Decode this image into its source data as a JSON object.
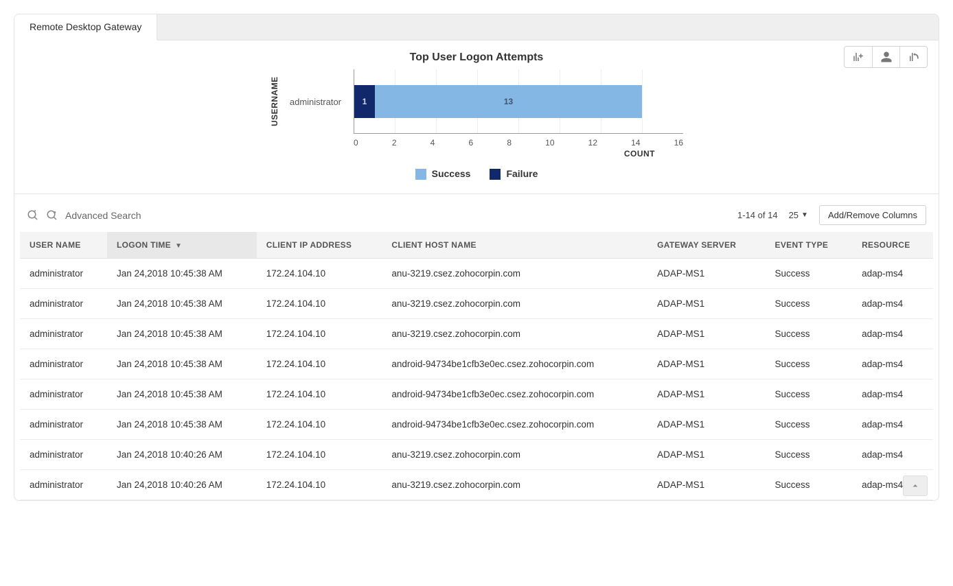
{
  "tabs": [
    {
      "label": "Remote Desktop Gateway",
      "active": true
    }
  ],
  "toolbar_icons": [
    "add-chart-icon",
    "user-silhouette-icon",
    "refresh-chart-icon"
  ],
  "chart_title": "Top User Logon Attempts",
  "chart_data": {
    "type": "bar",
    "orientation": "horizontal",
    "stacked": true,
    "categories": [
      "administrator"
    ],
    "series": [
      {
        "name": "Failure",
        "values": [
          1
        ],
        "color": "#11286b"
      },
      {
        "name": "Success",
        "values": [
          13
        ],
        "color": "#84b7e3"
      }
    ],
    "legend_order": [
      "Success",
      "Failure"
    ],
    "xlabel": "COUNT",
    "ylabel": "USERNAME",
    "xlim": [
      0,
      16
    ],
    "xticks": [
      0,
      2,
      4,
      6,
      8,
      10,
      12,
      14,
      16
    ],
    "grid": "x",
    "title": "Top User Logon Attempts"
  },
  "search": {
    "advanced_label": "Advanced Search"
  },
  "pager": {
    "range_text": "1-14 of 14",
    "page_size": "25"
  },
  "columns_button": "Add/Remove Columns",
  "table": {
    "sort_column_index": 1,
    "sort_dir": "desc",
    "columns": [
      "USER NAME",
      "LOGON TIME",
      "CLIENT IP ADDRESS",
      "CLIENT HOST NAME",
      "GATEWAY SERVER",
      "EVENT TYPE",
      "RESOURCE"
    ],
    "rows": [
      [
        "administrator",
        "Jan 24,2018 10:45:38 AM",
        "172.24.104.10",
        "anu-3219.csez.zohocorpin.com",
        "ADAP-MS1",
        "Success",
        "adap-ms4"
      ],
      [
        "administrator",
        "Jan 24,2018 10:45:38 AM",
        "172.24.104.10",
        "anu-3219.csez.zohocorpin.com",
        "ADAP-MS1",
        "Success",
        "adap-ms4"
      ],
      [
        "administrator",
        "Jan 24,2018 10:45:38 AM",
        "172.24.104.10",
        "anu-3219.csez.zohocorpin.com",
        "ADAP-MS1",
        "Success",
        "adap-ms4"
      ],
      [
        "administrator",
        "Jan 24,2018 10:45:38 AM",
        "172.24.104.10",
        "android-94734be1cfb3e0ec.csez.zohocorpin.com",
        "ADAP-MS1",
        "Success",
        "adap-ms4"
      ],
      [
        "administrator",
        "Jan 24,2018 10:45:38 AM",
        "172.24.104.10",
        "android-94734be1cfb3e0ec.csez.zohocorpin.com",
        "ADAP-MS1",
        "Success",
        "adap-ms4"
      ],
      [
        "administrator",
        "Jan 24,2018 10:45:38 AM",
        "172.24.104.10",
        "android-94734be1cfb3e0ec.csez.zohocorpin.com",
        "ADAP-MS1",
        "Success",
        "adap-ms4"
      ],
      [
        "administrator",
        "Jan 24,2018 10:40:26 AM",
        "172.24.104.10",
        "anu-3219.csez.zohocorpin.com",
        "ADAP-MS1",
        "Success",
        "adap-ms4"
      ],
      [
        "administrator",
        "Jan 24,2018 10:40:26 AM",
        "172.24.104.10",
        "anu-3219.csez.zohocorpin.com",
        "ADAP-MS1",
        "Success",
        "adap-ms4"
      ]
    ]
  }
}
